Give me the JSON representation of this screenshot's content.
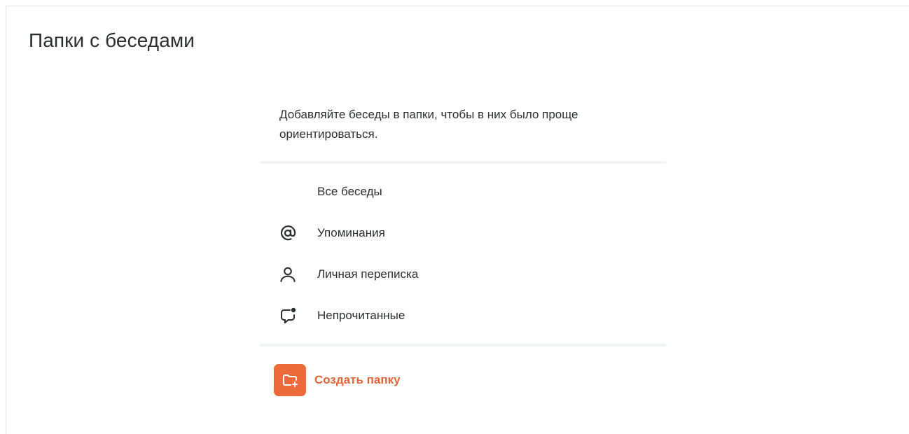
{
  "header": {
    "title": "Папки с беседами"
  },
  "description": "Добавляйте беседы в папки, чтобы в них было проще ориентироваться.",
  "folders": [
    {
      "label": "Все беседы",
      "icon": ""
    },
    {
      "label": "Упоминания",
      "icon": "at-sign-icon"
    },
    {
      "label": "Личная переписка",
      "icon": "person-icon"
    },
    {
      "label": "Непрочитанные",
      "icon": "unread-message-icon"
    }
  ],
  "create_folder": {
    "label": "Создать папку",
    "icon": "folder-plus-icon",
    "accent_color": "#ed6a3a",
    "text_color": "#e0653a"
  },
  "colors": {
    "text": "#2c2d2e",
    "divider": "#f2f3f5"
  }
}
